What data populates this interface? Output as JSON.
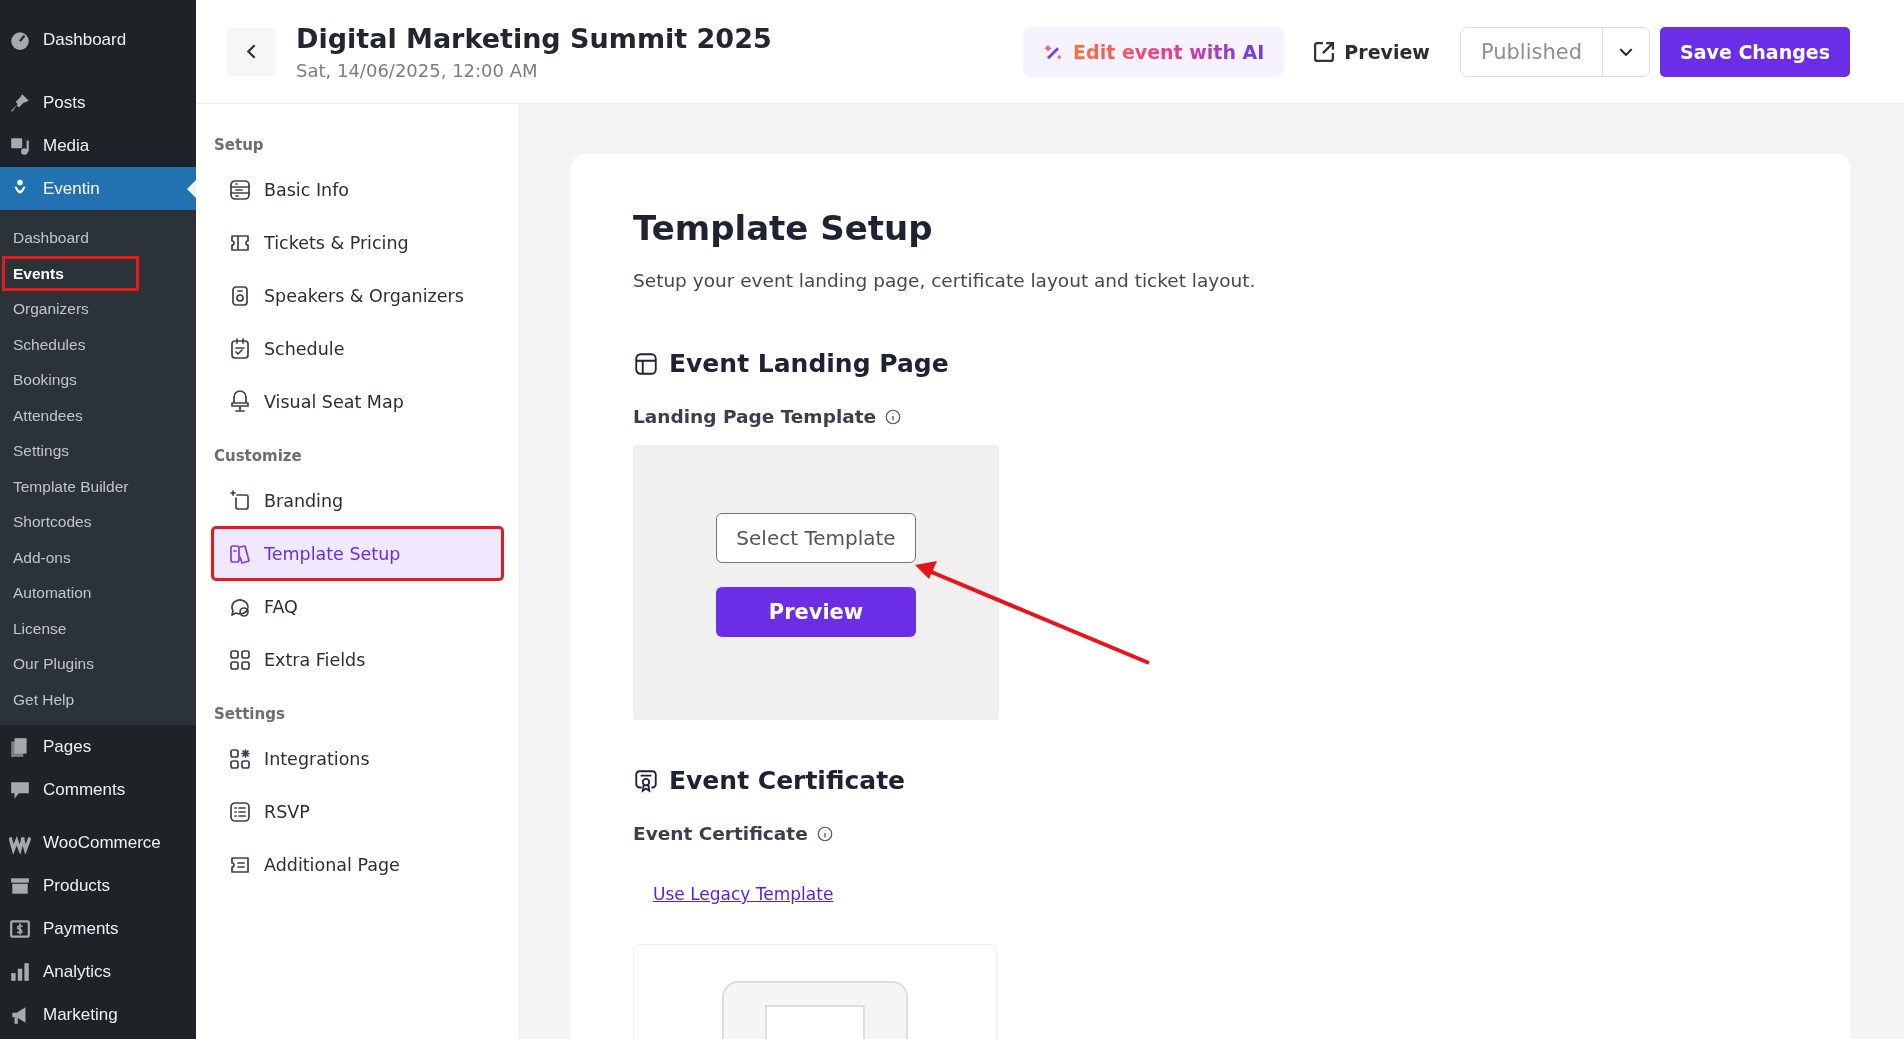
{
  "admin_menu": [
    {
      "items": [
        {
          "label": "Dashboard",
          "selected": false
        }
      ]
    },
    {
      "items": [
        {
          "label": "Posts",
          "selected": false
        },
        {
          "label": "Media",
          "selected": false
        },
        {
          "label": "Eventin",
          "selected": true,
          "submenu": [
            {
              "label": "Dashboard",
              "selected": false,
              "highlighted": false
            },
            {
              "label": "Events",
              "selected": true,
              "highlighted": true
            },
            {
              "label": "Organizers",
              "selected": false,
              "highlighted": false
            },
            {
              "label": "Schedules",
              "selected": false,
              "highlighted": false
            },
            {
              "label": "Bookings",
              "selected": false,
              "highlighted": false
            },
            {
              "label": "Attendees",
              "selected": false,
              "highlighted": false
            },
            {
              "label": "Settings",
              "selected": false,
              "highlighted": false
            },
            {
              "label": "Template Builder",
              "selected": false,
              "highlighted": false
            },
            {
              "label": "Shortcodes",
              "selected": false,
              "highlighted": false
            },
            {
              "label": "Add-ons",
              "selected": false,
              "highlighted": false
            },
            {
              "label": "Automation",
              "selected": false,
              "highlighted": false
            },
            {
              "label": "License",
              "selected": false,
              "highlighted": false
            },
            {
              "label": "Our Plugins",
              "selected": false,
              "highlighted": false
            },
            {
              "label": "Get Help",
              "selected": false,
              "highlighted": false
            }
          ]
        },
        {
          "label": "Pages",
          "selected": false
        },
        {
          "label": "Comments",
          "selected": false
        }
      ]
    },
    {
      "items": [
        {
          "label": "WooCommerce",
          "selected": false
        },
        {
          "label": "Products",
          "selected": false
        },
        {
          "label": "Payments",
          "selected": false
        },
        {
          "label": "Analytics",
          "selected": false
        },
        {
          "label": "Marketing",
          "selected": false
        }
      ]
    }
  ],
  "header": {
    "title": "Digital Marketing Summit 2025",
    "date": "Sat, 14/06/2025, 12:00 AM",
    "ai_button": "Edit event with AI",
    "preview_button": "Preview",
    "status": "Published",
    "save_button": "Save Changes"
  },
  "event_nav": [
    {
      "title": "Setup",
      "items": [
        {
          "label": "Basic Info",
          "selected": false,
          "highlighted": false
        },
        {
          "label": "Tickets & Pricing",
          "selected": false,
          "highlighted": false
        },
        {
          "label": "Speakers & Organizers",
          "selected": false,
          "highlighted": false
        },
        {
          "label": "Schedule",
          "selected": false,
          "highlighted": false
        },
        {
          "label": "Visual Seat Map",
          "selected": false,
          "highlighted": false
        }
      ]
    },
    {
      "title": "Customize",
      "items": [
        {
          "label": "Branding",
          "selected": false,
          "highlighted": false
        },
        {
          "label": "Template Setup",
          "selected": true,
          "highlighted": true
        },
        {
          "label": "FAQ",
          "selected": false,
          "highlighted": false
        },
        {
          "label": "Extra Fields",
          "selected": false,
          "highlighted": false
        }
      ]
    },
    {
      "title": "Settings",
      "items": [
        {
          "label": "Integrations",
          "selected": false,
          "highlighted": false
        },
        {
          "label": "RSVP",
          "selected": false,
          "highlighted": false
        },
        {
          "label": "Additional Page",
          "selected": false,
          "highlighted": false
        }
      ]
    }
  ],
  "content": {
    "title": "Template Setup",
    "description": "Setup your event landing page, certificate layout and ticket layout.",
    "landing": {
      "heading": "Event Landing Page",
      "label": "Landing Page Template",
      "select_button": "Select Template",
      "preview_button": "Preview"
    },
    "certificate": {
      "heading": "Event Certificate",
      "label": "Event Certificate",
      "legacy_link": "Use Legacy Template"
    }
  }
}
